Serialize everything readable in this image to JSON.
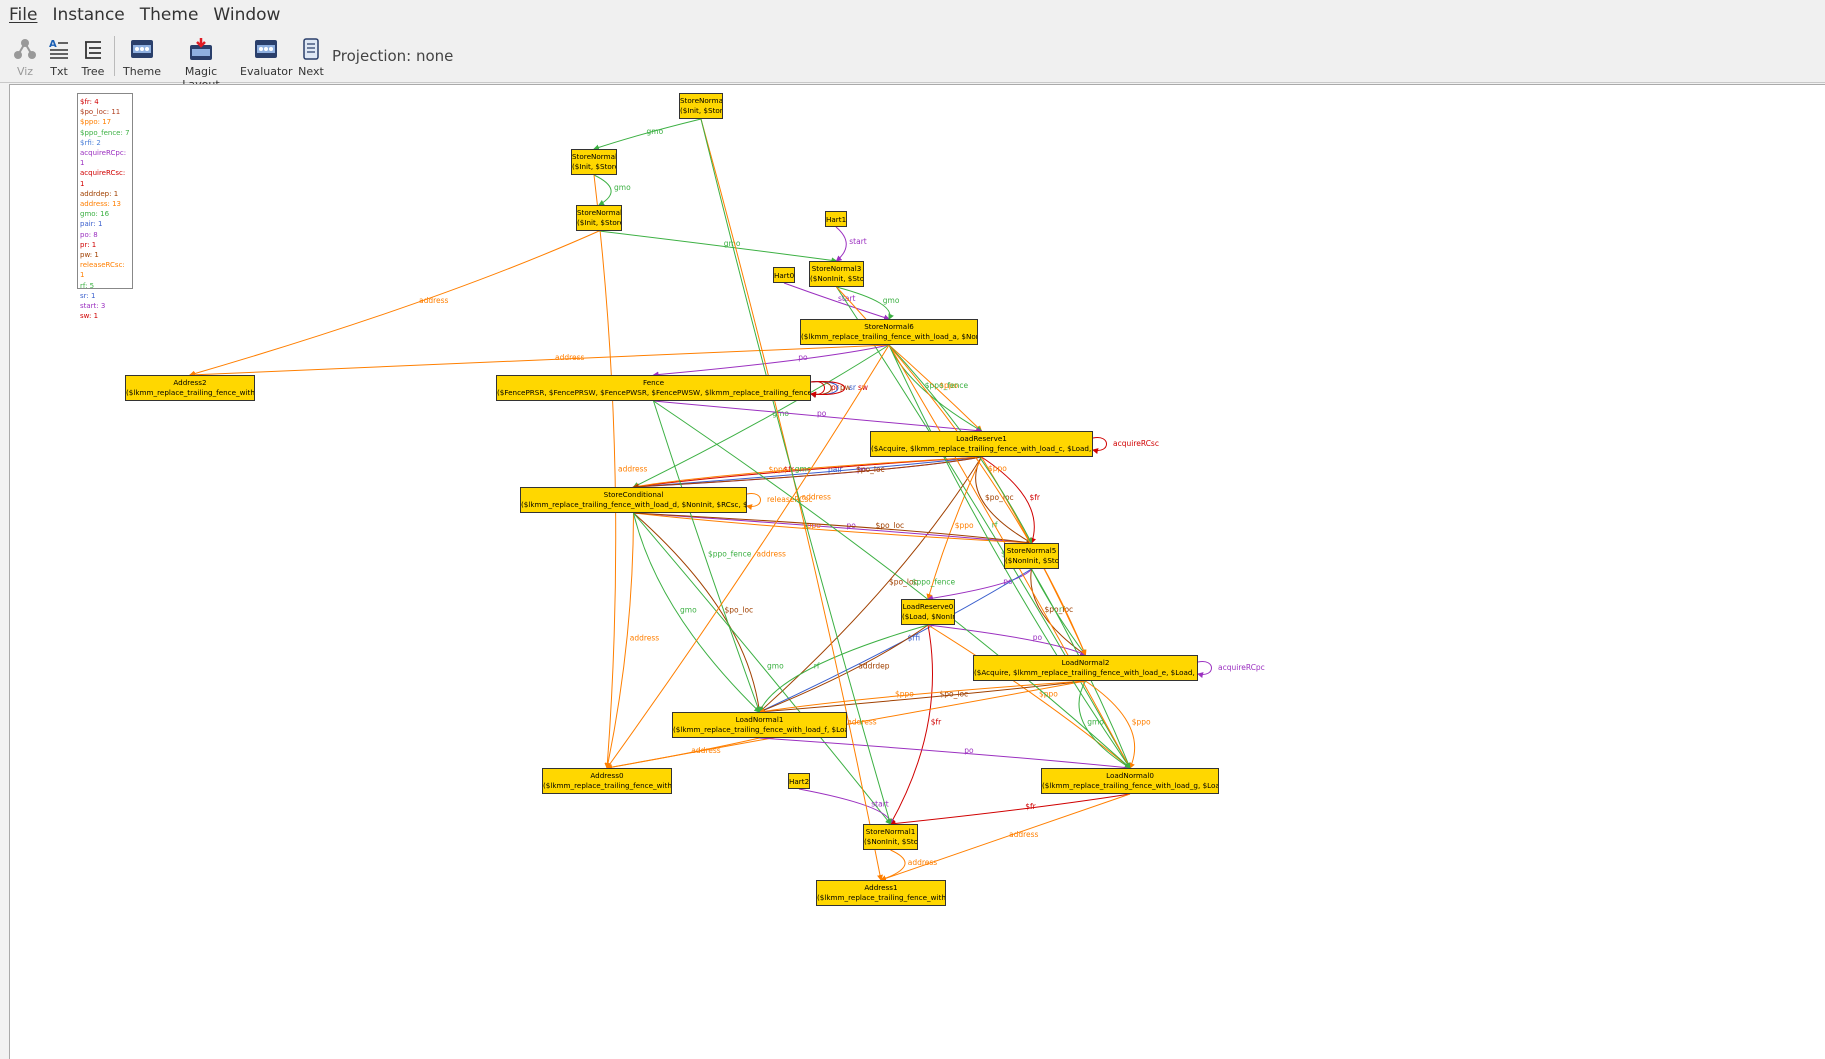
{
  "menu": {
    "file": "File",
    "instance": "Instance",
    "theme": "Theme",
    "window": "Window"
  },
  "toolbar": {
    "viz": "Viz",
    "txt": "Txt",
    "tree": "Tree",
    "theme": "Theme",
    "magic_layout": "Magic Layout",
    "evaluator": "Evaluator",
    "next": "Next",
    "projection": "Projection: none"
  },
  "legend": [
    {
      "text": "$fr: 4",
      "color": "#d00000"
    },
    {
      "text": "$po_loc: 11",
      "color": "#b04020"
    },
    {
      "text": "$ppo: 17",
      "color": "#ff7f00"
    },
    {
      "text": "$ppo_fence: 7",
      "color": "#3cb043"
    },
    {
      "text": "$rfi: 2",
      "color": "#4a7fd8"
    },
    {
      "text": "acquireRCpc: 1",
      "color": "#9b30c0"
    },
    {
      "text": "acquireRCsc: 1",
      "color": "#d00000"
    },
    {
      "text": "addrdep: 1",
      "color": "#a04000"
    },
    {
      "text": "address: 13",
      "color": "#ff7f00"
    },
    {
      "text": "gmo: 16",
      "color": "#3cb043"
    },
    {
      "text": "pair: 1",
      "color": "#3a5fcd"
    },
    {
      "text": "po: 8",
      "color": "#9b30c0"
    },
    {
      "text": "pr: 1",
      "color": "#d00000"
    },
    {
      "text": "pw: 1",
      "color": "#a04000"
    },
    {
      "text": "releaseRCsc: 1",
      "color": "#ff7f00"
    },
    {
      "text": "rf: 5",
      "color": "#3cb043"
    },
    {
      "text": "sr: 1",
      "color": "#3a5fcd"
    },
    {
      "text": "start: 3",
      "color": "#9b30c0"
    },
    {
      "text": "sw: 1",
      "color": "#d00000"
    }
  ],
  "nodes": [
    {
      "id": "StoreNormal4",
      "lines": [
        "StoreNormal4",
        "($Init, $Store)"
      ]
    },
    {
      "id": "StoreNormal0",
      "lines": [
        "StoreNormal0",
        "($Init, $Store)"
      ]
    },
    {
      "id": "StoreNormal2",
      "lines": [
        "StoreNormal2",
        "($Init, $Store)"
      ]
    },
    {
      "id": "Hart1",
      "lines": [
        "Hart1"
      ]
    },
    {
      "id": "Hart0",
      "lines": [
        "Hart0"
      ]
    },
    {
      "id": "StoreNormal3",
      "lines": [
        "StoreNormal3",
        "($NonInit, $Store)"
      ]
    },
    {
      "id": "StoreNormal6",
      "lines": [
        "StoreNormal6",
        "($lkmm_replace_trailing_fence_with_load_a, $NonInit, $Store)"
      ]
    },
    {
      "id": "Address2",
      "lines": [
        "Address2",
        "($lkmm_replace_trailing_fence_with_load_x)"
      ]
    },
    {
      "id": "Fence",
      "lines": [
        "Fence",
        "($FencePRSR, $FencePRSW, $FencePWSR, $FencePWSW, $lkmm_replace_trailing_fence_with_load_b, $NonInit)"
      ]
    },
    {
      "id": "LoadReserve1",
      "lines": [
        "LoadReserve1",
        "($Acquire, $lkmm_replace_trailing_fence_with_load_c, $Load, $NonInit, $RCsc)"
      ]
    },
    {
      "id": "StoreConditional",
      "lines": [
        "StoreConditional",
        "($lkmm_replace_trailing_fence_with_load_d, $NonInit, $RCsc, $Release, $Store)"
      ]
    },
    {
      "id": "StoreNormal5",
      "lines": [
        "StoreNormal5",
        "($NonInit, $Store)"
      ]
    },
    {
      "id": "LoadReserve0",
      "lines": [
        "LoadReserve0",
        "($Load, $NonInit)"
      ]
    },
    {
      "id": "LoadNormal2",
      "lines": [
        "LoadNormal2",
        "($Acquire, $lkmm_replace_trailing_fence_with_load_e, $Load, $NonInit, $RCpc)"
      ]
    },
    {
      "id": "LoadNormal1",
      "lines": [
        "LoadNormal1",
        "($lkmm_replace_trailing_fence_with_load_f, $Load, $NonInit)"
      ]
    },
    {
      "id": "Address0",
      "lines": [
        "Address0",
        "($lkmm_replace_trailing_fence_with_load_z)"
      ]
    },
    {
      "id": "Hart2",
      "lines": [
        "Hart2"
      ]
    },
    {
      "id": "LoadNormal0",
      "lines": [
        "LoadNormal0",
        "($lkmm_replace_trailing_fence_with_load_g, $Load, $NonInit)"
      ]
    },
    {
      "id": "StoreNormal1",
      "lines": [
        "StoreNormal1",
        "($NonInit, $Store)"
      ]
    },
    {
      "id": "Address1",
      "lines": [
        "Address1",
        "($lkmm_replace_trailing_fence_with_load_y)"
      ]
    }
  ],
  "edge_colors": {
    "green": "#3cb043",
    "orange": "#ff7f00",
    "purple": "#9b30c0",
    "red": "#d00000",
    "brown": "#a04000",
    "blue": "#3a5fcd"
  },
  "edges": [
    {
      "from": "StoreNormal4",
      "to": "StoreNormal0",
      "label": "gmo",
      "color": "green"
    },
    {
      "from": "StoreNormal0",
      "to": "StoreNormal2",
      "label": "gmo",
      "color": "green"
    },
    {
      "from": "StoreNormal2",
      "to": "StoreNormal3",
      "label": "gmo",
      "color": "green"
    },
    {
      "from": "StoreNormal2",
      "to": "Address2",
      "label": "address",
      "color": "orange"
    },
    {
      "from": "Hart1",
      "to": "StoreNormal3",
      "label": "start",
      "color": "purple"
    },
    {
      "from": "Hart0",
      "to": "StoreNormal6",
      "label": "start",
      "color": "purple"
    },
    {
      "from": "StoreNormal3",
      "to": "StoreNormal6",
      "label": "gmo",
      "color": "green"
    },
    {
      "from": "StoreNormal3",
      "to": "LoadNormal0",
      "label": "rf",
      "color": "green"
    },
    {
      "from": "StoreNormal6",
      "to": "Fence",
      "label": "po",
      "color": "purple"
    },
    {
      "from": "StoreNormal6",
      "to": "Address2",
      "label": "address",
      "color": "orange"
    },
    {
      "from": "StoreNormal6",
      "to": "LoadReserve1",
      "label": "$ppo",
      "color": "orange"
    },
    {
      "from": "StoreNormal6",
      "to": "LoadReserve1",
      "label": "$ppo_fence",
      "color": "green"
    },
    {
      "from": "StoreNormal6",
      "to": "StoreConditional",
      "label": "gmo",
      "color": "green"
    },
    {
      "from": "Fence",
      "to": "LoadReserve1",
      "label": "po",
      "color": "purple"
    },
    {
      "from": "Fence",
      "to": "Fence",
      "label": "pr",
      "color": "red"
    },
    {
      "from": "Fence",
      "to": "Fence",
      "label": "pw",
      "color": "brown"
    },
    {
      "from": "Fence",
      "to": "Fence",
      "label": "sr",
      "color": "blue"
    },
    {
      "from": "Fence",
      "to": "Fence",
      "label": "sw",
      "color": "red"
    },
    {
      "from": "LoadReserve1",
      "to": "LoadReserve1",
      "label": "acquireRCsc",
      "color": "red"
    },
    {
      "from": "LoadReserve1",
      "to": "StoreConditional",
      "label": "pair",
      "color": "blue"
    },
    {
      "from": "LoadReserve1",
      "to": "StoreConditional",
      "label": "$fr",
      "color": "red"
    },
    {
      "from": "LoadReserve1",
      "to": "StoreConditional",
      "label": "po",
      "color": "purple"
    },
    {
      "from": "LoadReserve1",
      "to": "StoreConditional",
      "label": "$ppo",
      "color": "orange"
    },
    {
      "from": "LoadReserve1",
      "to": "StoreConditional",
      "label": "$po_loc",
      "color": "brown"
    },
    {
      "from": "LoadReserve1",
      "to": "StoreNormal5",
      "label": "$fr",
      "color": "red"
    },
    {
      "from": "LoadReserve1",
      "to": "StoreNormal5",
      "label": "$po_loc",
      "color": "brown"
    },
    {
      "from": "LoadReserve1",
      "to": "LoadReserve0",
      "label": "$ppo",
      "color": "orange"
    },
    {
      "from": "LoadReserve1",
      "to": "LoadNormal1",
      "label": "$po_loc",
      "color": "brown"
    },
    {
      "from": "LoadReserve1",
      "to": "LoadNormal2",
      "label": "$ppo",
      "color": "orange"
    },
    {
      "from": "StoreConditional",
      "to": "StoreConditional",
      "label": "releaseRCsc",
      "color": "orange"
    },
    {
      "from": "StoreConditional",
      "to": "StoreNormal5",
      "label": "po",
      "color": "purple"
    },
    {
      "from": "StoreConditional",
      "to": "StoreNormal5",
      "label": "$ppo",
      "color": "orange"
    },
    {
      "from": "StoreConditional",
      "to": "StoreNormal5",
      "label": "$po_loc",
      "color": "brown"
    },
    {
      "from": "StoreConditional",
      "to": "Address0",
      "label": "address",
      "color": "orange"
    },
    {
      "from": "StoreConditional",
      "to": "LoadNormal1",
      "label": "$po_loc",
      "color": "brown"
    },
    {
      "from": "StoreConditional",
      "to": "LoadNormal1",
      "label": "gmo",
      "color": "green"
    },
    {
      "from": "StoreConditional",
      "to": "StoreNormal1",
      "label": "gmo",
      "color": "green"
    },
    {
      "from": "StoreNormal5",
      "to": "LoadReserve0",
      "label": "po",
      "color": "purple"
    },
    {
      "from": "StoreNormal5",
      "to": "LoadNormal1",
      "label": "$rfi",
      "color": "blue"
    },
    {
      "from": "StoreNormal5",
      "to": "LoadNormal2",
      "label": "rf",
      "color": "green"
    },
    {
      "from": "StoreNormal5",
      "to": "LoadNormal2",
      "label": "$po_loc",
      "color": "brown"
    },
    {
      "from": "StoreNormal5",
      "to": "LoadNormal0",
      "label": "gmo",
      "color": "green"
    },
    {
      "from": "LoadReserve0",
      "to": "LoadNormal2",
      "label": "po",
      "color": "purple"
    },
    {
      "from": "LoadReserve0",
      "to": "LoadNormal1",
      "label": "addrdep",
      "color": "brown"
    },
    {
      "from": "LoadReserve0",
      "to": "LoadNormal1",
      "label": "rf",
      "color": "green"
    },
    {
      "from": "LoadReserve0",
      "to": "StoreNormal1",
      "label": "$fr",
      "color": "red"
    },
    {
      "from": "LoadReserve0",
      "to": "LoadNormal0",
      "label": "$ppo",
      "color": "orange"
    },
    {
      "from": "LoadNormal2",
      "to": "LoadNormal2",
      "label": "acquireRCpc",
      "color": "purple"
    },
    {
      "from": "LoadNormal2",
      "to": "LoadNormal1",
      "label": "$po_loc",
      "color": "brown"
    },
    {
      "from": "LoadNormal2",
      "to": "LoadNormal1",
      "label": "$ppo",
      "color": "orange"
    },
    {
      "from": "LoadNormal2",
      "to": "LoadNormal0",
      "label": "$ppo",
      "color": "orange"
    },
    {
      "from": "LoadNormal2",
      "to": "LoadNormal0",
      "label": "gmo",
      "color": "green"
    },
    {
      "from": "LoadNormal2",
      "to": "Address0",
      "label": "address",
      "color": "orange"
    },
    {
      "from": "LoadNormal1",
      "to": "LoadNormal0",
      "label": "po",
      "color": "purple"
    },
    {
      "from": "LoadNormal1",
      "to": "Address0",
      "label": "address",
      "color": "orange"
    },
    {
      "from": "Hart2",
      "to": "StoreNormal1",
      "label": "start",
      "color": "purple"
    },
    {
      "from": "LoadNormal0",
      "to": "StoreNormal1",
      "label": "$fr",
      "color": "red"
    },
    {
      "from": "LoadNormal0",
      "to": "Address1",
      "label": "address",
      "color": "orange"
    },
    {
      "from": "StoreNormal1",
      "to": "Address1",
      "label": "address",
      "color": "orange"
    },
    {
      "from": "StoreNormal4",
      "to": "Address1",
      "label": "address",
      "color": "orange"
    },
    {
      "from": "StoreNormal4",
      "to": "StoreNormal1",
      "label": "gmo",
      "color": "green"
    },
    {
      "from": "StoreNormal0",
      "to": "Address0",
      "label": "address",
      "color": "orange"
    },
    {
      "from": "StoreNormal6",
      "to": "LoadNormal0",
      "label": "$ppo",
      "color": "orange"
    },
    {
      "from": "StoreNormal6",
      "to": "LoadNormal0",
      "label": "$ppo_fence",
      "color": "green"
    },
    {
      "from": "StoreNormal6",
      "to": "StoreNormal5",
      "label": "gmo",
      "color": "green"
    },
    {
      "from": "Fence",
      "to": "LoadNormal1",
      "label": "$ppo_fence",
      "color": "green"
    },
    {
      "from": "Fence",
      "to": "LoadNormal0",
      "label": "$ppo_fence",
      "color": "green"
    },
    {
      "from": "StoreNormal6",
      "to": "Address0",
      "label": "address",
      "color": "orange"
    },
    {
      "from": "StoreNormal3",
      "to": "LoadNormal2",
      "label": "$ppo",
      "color": "orange"
    }
  ]
}
